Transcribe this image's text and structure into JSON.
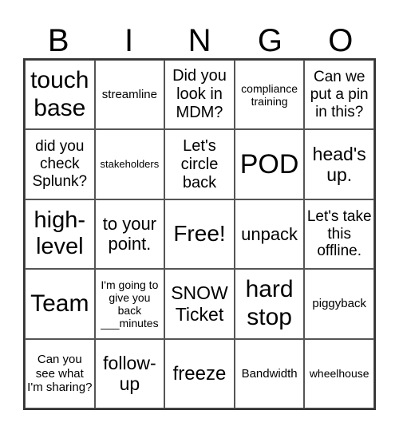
{
  "header": [
    "B",
    "I",
    "N",
    "G",
    "O"
  ],
  "cells": [
    {
      "text": "touch base",
      "size": 30
    },
    {
      "text": "streamline",
      "size": 15
    },
    {
      "text": "Did you look in MDM?",
      "size": 20
    },
    {
      "text": "compliance training",
      "size": 14
    },
    {
      "text": "Can we put a pin in this?",
      "size": 19
    },
    {
      "text": "did you check Splunk?",
      "size": 19
    },
    {
      "text": "stakeholders",
      "size": 13
    },
    {
      "text": "Let's circle back",
      "size": 20
    },
    {
      "text": "POD",
      "size": 34
    },
    {
      "text": "head's up.",
      "size": 23
    },
    {
      "text": "high-level",
      "size": 29
    },
    {
      "text": "to your point.",
      "size": 22
    },
    {
      "text": "Free!",
      "size": 28
    },
    {
      "text": "unpack",
      "size": 22
    },
    {
      "text": "Let's take this offline.",
      "size": 19
    },
    {
      "text": "Team",
      "size": 30
    },
    {
      "text": "I'm going to give you back ___minutes",
      "size": 14
    },
    {
      "text": "SNOW Ticket",
      "size": 23
    },
    {
      "text": "hard stop",
      "size": 30
    },
    {
      "text": "piggyback",
      "size": 15
    },
    {
      "text": "Can you see what I'm sharing?",
      "size": 15
    },
    {
      "text": "follow-up",
      "size": 23
    },
    {
      "text": "freeze",
      "size": 24
    },
    {
      "text": "Bandwidth",
      "size": 15
    },
    {
      "text": "wheelhouse",
      "size": 14
    }
  ]
}
